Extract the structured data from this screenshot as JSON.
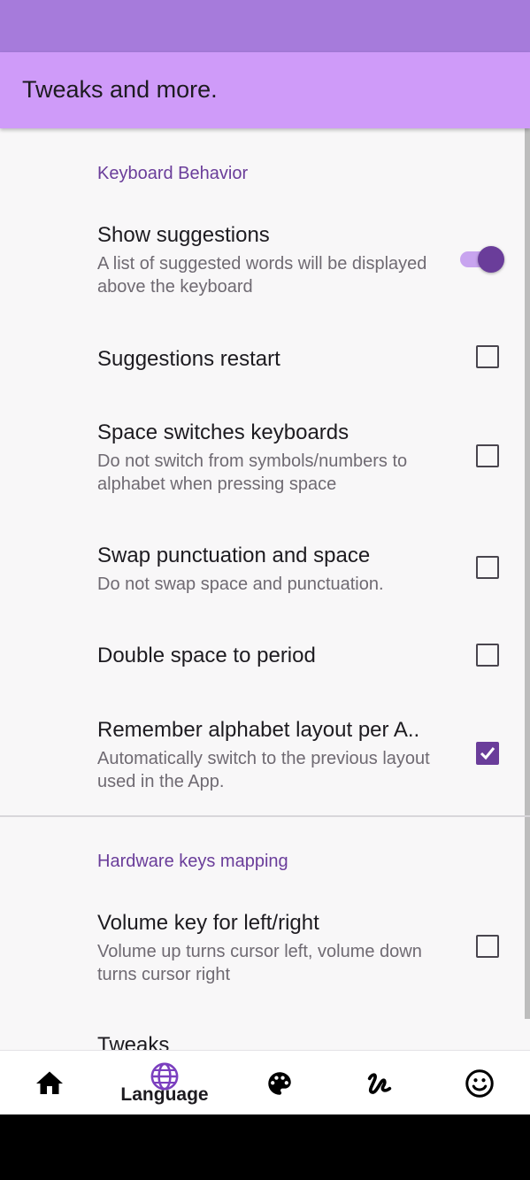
{
  "app_bar": {
    "title": "Tweaks and more."
  },
  "sections": {
    "keyboard_behavior": {
      "title": "Keyboard Behavior",
      "items": [
        {
          "title": "Show suggestions",
          "summary": "A list of suggested words will be displayed above the keyboard",
          "control": "switch",
          "checked": true
        },
        {
          "title": "Suggestions restart",
          "summary": "",
          "control": "checkbox",
          "checked": false
        },
        {
          "title": "Space switches keyboards",
          "summary": "Do not switch from symbols/numbers to alphabet when pressing space",
          "control": "checkbox",
          "checked": false
        },
        {
          "title": "Swap punctuation and space",
          "summary": "Do not swap space and punctuation.",
          "control": "checkbox",
          "checked": false
        },
        {
          "title": "Double space to period",
          "summary": "",
          "control": "checkbox",
          "checked": false
        },
        {
          "title": "Remember alphabet layout per A..",
          "summary": "Automatically switch to the previous layout used in the App.",
          "control": "checkbox",
          "checked": true
        }
      ]
    },
    "hardware_keys": {
      "title": "Hardware keys mapping",
      "items": [
        {
          "title": "Volume key for left/right",
          "summary": "Volume up turns cursor left, volume down turns cursor right",
          "control": "checkbox",
          "checked": false
        }
      ]
    },
    "next_section_partial": "Tweaks"
  },
  "bottom_nav": {
    "items": [
      {
        "icon": "home-icon",
        "label": ""
      },
      {
        "icon": "globe-icon",
        "label": "Language"
      },
      {
        "icon": "palette-icon",
        "label": ""
      },
      {
        "icon": "gesture-icon",
        "label": ""
      },
      {
        "icon": "emoji-icon",
        "label": ""
      }
    ]
  },
  "colors": {
    "status_bar": "#a67bdb",
    "app_bar": "#cf9bf9",
    "accent": "#6a3d9a",
    "background": "#f8f7f8"
  }
}
